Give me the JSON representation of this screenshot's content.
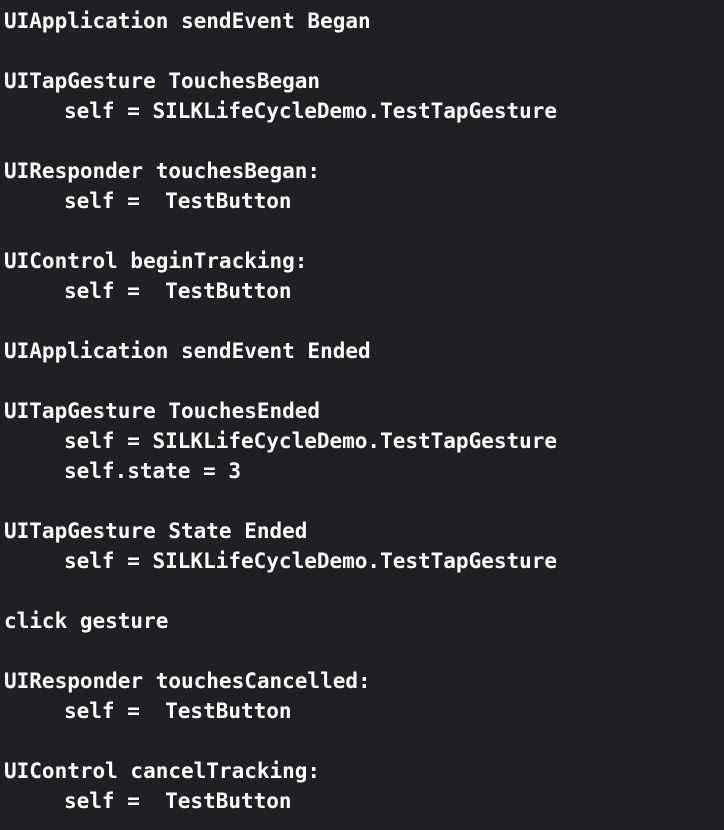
{
  "console": {
    "lines": [
      {
        "text": "UIApplication sendEvent Began",
        "indent": false
      },
      {
        "text": "",
        "indent": false
      },
      {
        "text": "UITapGesture TouchesBegan",
        "indent": false
      },
      {
        "text": "self = SILKLifeCycleDemo.TestTapGesture",
        "indent": true
      },
      {
        "text": "",
        "indent": false
      },
      {
        "text": "UIResponder touchesBegan:",
        "indent": false
      },
      {
        "text": "self =  TestButton",
        "indent": true
      },
      {
        "text": "",
        "indent": false
      },
      {
        "text": "UIControl beginTracking:",
        "indent": false
      },
      {
        "text": "self =  TestButton",
        "indent": true
      },
      {
        "text": "",
        "indent": false
      },
      {
        "text": "UIApplication sendEvent Ended",
        "indent": false
      },
      {
        "text": "",
        "indent": false
      },
      {
        "text": "UITapGesture TouchesEnded",
        "indent": false
      },
      {
        "text": "self = SILKLifeCycleDemo.TestTapGesture",
        "indent": true
      },
      {
        "text": "self.state = 3",
        "indent": true
      },
      {
        "text": "",
        "indent": false
      },
      {
        "text": "UITapGesture State Ended",
        "indent": false
      },
      {
        "text": "self = SILKLifeCycleDemo.TestTapGesture",
        "indent": true
      },
      {
        "text": "",
        "indent": false
      },
      {
        "text": "click gesture",
        "indent": false
      },
      {
        "text": "",
        "indent": false
      },
      {
        "text": "UIResponder touchesCancelled:",
        "indent": false
      },
      {
        "text": "self =  TestButton",
        "indent": true
      },
      {
        "text": "",
        "indent": false
      },
      {
        "text": "UIControl cancelTracking:",
        "indent": false
      },
      {
        "text": "self =  TestButton",
        "indent": true
      }
    ]
  },
  "colors": {
    "background": "#1f1f24",
    "text": "#ffffff"
  }
}
